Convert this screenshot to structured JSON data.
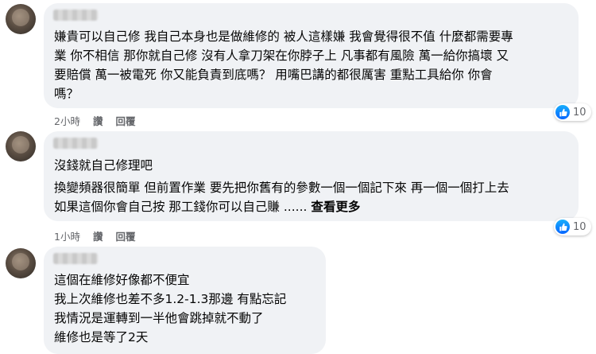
{
  "comments": [
    {
      "text": "嫌貴可以自己修 我自己本身也是做維修的 被人這樣嫌 我會覺得很不值 什麼都需要專\n業 你不相信 那你就自己修 沒有人拿刀架在你脖子上 凡事都有風險 萬一給你搞壞 又\n要賠償 萬一被電死 你又能負責到底嗎？ 用嘴巴講的都很厲害 重點工具給你 你會\n嗎？",
      "time": "2小時",
      "like_label": "讚",
      "reply_label": "回覆",
      "reaction_count": "10"
    },
    {
      "text_line1": "沒錢就自己修理吧",
      "text_para": "換變頻器很簡單 但前置作業 要先把你舊有的參數一個一個記下來 再一個一個打上去\n如果這個你會自己按 那工錢你可以自己賺 ......",
      "see_more": "查看更多",
      "time": "1小時",
      "like_label": "讚",
      "reply_label": "回覆",
      "reaction_count": "10"
    },
    {
      "text": "這個在維修好像都不便宜\n我上次維修也差不多1.2-1.3那邊 有點忘記\n我情況是運轉到一半他會跳掉就不動了\n維修也是等了2天"
    }
  ],
  "colors": {
    "bubble": "#f0f2f5",
    "like_blue": "#0866ff",
    "meta_gray": "#65676b"
  }
}
